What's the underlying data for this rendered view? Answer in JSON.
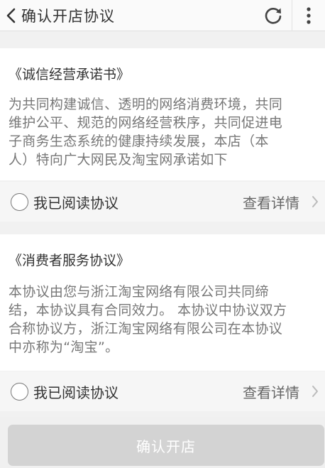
{
  "header": {
    "title": "确认开店协议",
    "back_icon": "chevron-left-icon",
    "refresh_icon": "refresh-icon",
    "more_icon": "more-vertical-icon"
  },
  "agreements": [
    {
      "title": "《诚信经营承诺书》",
      "body_lines": [
        "为共同构建诚信、透明的网络消费环境，共同",
        "维护公平、规范的网络经营秩序，共同促进电",
        "子商务生态系统的健康持续发展，本店（本",
        "人）特向广大网民及淘宝网承诺如下"
      ],
      "agree_label": "我已阅读协议",
      "detail_label": "查看详情"
    },
    {
      "title": "《消费者服务协议》",
      "body_lines": [
        "本协议由您与浙江淘宝网络有限公司共同缔",
        "结，本协议具有合同效力。 本协议中协议双方",
        "合称协议方，浙江淘宝网络有限公司在本协议",
        "中亦称为“淘宝”。"
      ],
      "agree_label": "我已阅读协议",
      "detail_label": "查看详情"
    }
  ],
  "footer": {
    "confirm_label": "确认开店"
  },
  "colors": {
    "button_disabled": "#d3d3d3",
    "body_text": "#777777",
    "title_text": "#333333"
  }
}
